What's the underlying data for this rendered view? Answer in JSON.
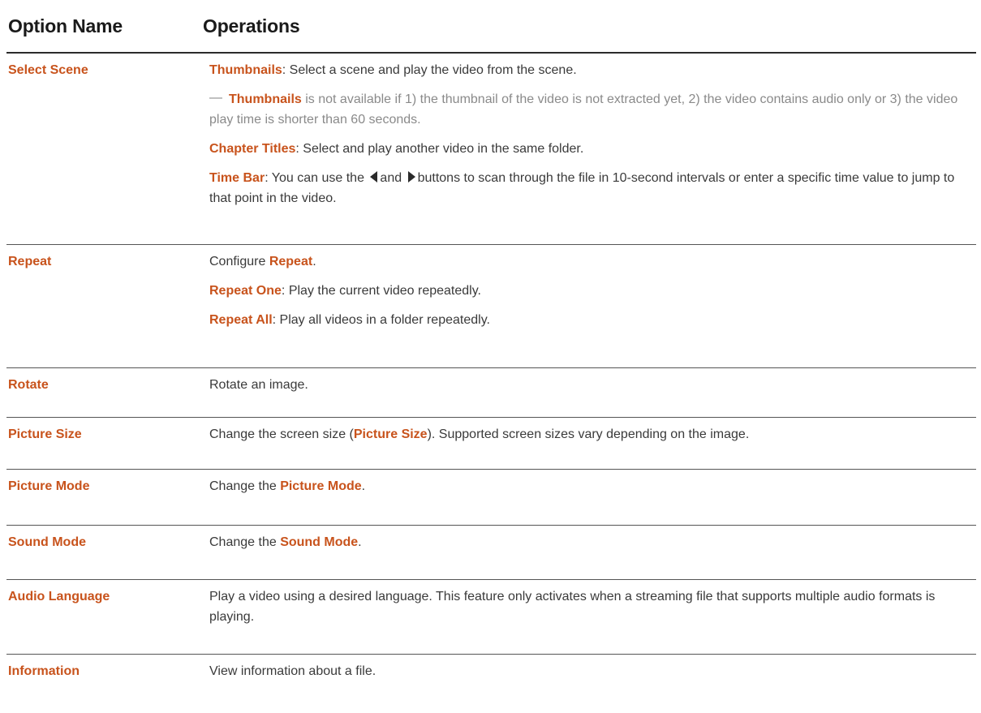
{
  "header": {
    "col_name": "Option Name",
    "col_ops": "Operations"
  },
  "rows": [
    {
      "name": "Select Scene",
      "thumbnails_label": "Thumbnails",
      "thumbnails_text": ": Select a scene and play the video from the scene.",
      "note_dash": "—",
      "note_label": "Thumbnails",
      "note_text": " is not available if 1) the thumbnail of the video is not extracted yet, 2) the video contains audio only or 3) the video play time is shorter than 60 seconds.",
      "chapter_label": "Chapter Titles",
      "chapter_text": ": Select and play another video in the same folder.",
      "timebar_label": "Time Bar",
      "timebar_text_1": ": You can use the",
      "timebar_text_and": "and",
      "timebar_text_2": "buttons to scan through the file in 10-second intervals or enter a specific time value to jump to that point in the video."
    },
    {
      "name": "Repeat",
      "configure_text": "Configure ",
      "configure_label": "Repeat",
      "period": ".",
      "one_label": "Repeat One",
      "one_text": ": Play the current video repeatedly.",
      "all_label": "Repeat All",
      "all_text": ": Play all videos in a folder repeatedly."
    },
    {
      "name": "Rotate",
      "text": "Rotate an image."
    },
    {
      "name": "Picture Size",
      "text_1": "Change the screen size (",
      "label": "Picture Size",
      "text_2": "). Supported screen sizes vary depending on the image."
    },
    {
      "name": "Picture Mode",
      "text_1": "Change the ",
      "label": "Picture Mode",
      "text_2": "."
    },
    {
      "name": "Sound Mode",
      "text_1": "Change the ",
      "label": "Sound Mode",
      "text_2": "."
    },
    {
      "name": "Audio Language",
      "text": "Play a video using a desired language. This feature only activates when a streaming file that supports multiple audio formats is playing."
    },
    {
      "name": "Information",
      "text": "View information about a file."
    }
  ],
  "colors": {
    "accent": "#c8531c",
    "text": "#3a3a3a",
    "note": "#8a8a8a",
    "rule": "#555555"
  }
}
